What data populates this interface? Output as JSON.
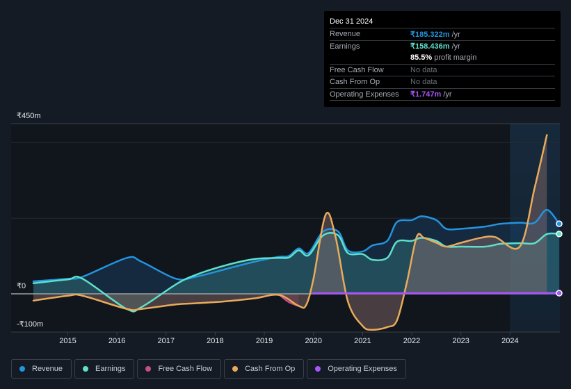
{
  "tooltip": {
    "date": "Dec 31 2024",
    "rows": [
      {
        "label": "Revenue",
        "value": "₹185.322m",
        "unit": " /yr",
        "color": "#2394df"
      },
      {
        "label": "Earnings",
        "value": "₹158.436m",
        "unit": " /yr",
        "color": "#5ee0cb"
      },
      {
        "label": "",
        "value": "85.5%",
        "unit": " profit margin",
        "color": "#ffffff"
      },
      {
        "label": "Free Cash Flow",
        "value": "No data",
        "unit": "",
        "color": "#6b7078"
      },
      {
        "label": "Cash From Op",
        "value": "No data",
        "unit": "",
        "color": "#6b7078"
      },
      {
        "label": "Operating Expenses",
        "value": "₹1.747m",
        "unit": " /yr",
        "color": "#a855f7"
      }
    ]
  },
  "legend": [
    {
      "label": "Revenue",
      "color": "#2394df"
    },
    {
      "label": "Earnings",
      "color": "#5ee0cb"
    },
    {
      "label": "Free Cash Flow",
      "color": "#c44e86"
    },
    {
      "label": "Cash From Op",
      "color": "#e9ab5b"
    },
    {
      "label": "Operating Expenses",
      "color": "#a855f7"
    }
  ],
  "chart_data": {
    "type": "area",
    "title": "",
    "xlabel": "",
    "ylabel": "",
    "y_tick_labels": [
      "₹450m",
      "₹0",
      "-₹100m"
    ],
    "x_tick_labels": [
      "2015",
      "2016",
      "2017",
      "2018",
      "2019",
      "2020",
      "2021",
      "2022",
      "2023",
      "2024"
    ],
    "ylim": [
      -100,
      450
    ],
    "xlim": [
      2014.3,
      2025.0
    ],
    "highlight_from": 2024.0,
    "series": [
      {
        "name": "Revenue",
        "color": "#2394df",
        "x": [
          2014.3,
          2015.0,
          2015.3,
          2016.2,
          2016.5,
          2017.2,
          2017.6,
          2018.2,
          2018.8,
          2019.3,
          2019.5,
          2019.7,
          2019.9,
          2020.2,
          2020.5,
          2020.7,
          2021.0,
          2021.2,
          2021.5,
          2021.7,
          2022.0,
          2022.2,
          2022.5,
          2022.7,
          2023.0,
          2023.5,
          2023.8,
          2024.2,
          2024.5,
          2024.75,
          2025.0
        ],
        "values": [
          33,
          40,
          45,
          95,
          85,
          40,
          45,
          65,
          85,
          98,
          100,
          120,
          108,
          165,
          165,
          115,
          112,
          128,
          140,
          190,
          195,
          205,
          195,
          172,
          172,
          178,
          185,
          188,
          188,
          222,
          185.3
        ]
      },
      {
        "name": "Earnings",
        "color": "#5ee0cb",
        "x": [
          2014.3,
          2015.0,
          2015.3,
          2016.2,
          2016.5,
          2017.2,
          2017.6,
          2018.2,
          2018.8,
          2019.3,
          2019.5,
          2019.7,
          2019.9,
          2020.2,
          2020.5,
          2020.7,
          2021.0,
          2021.2,
          2021.5,
          2021.7,
          2022.0,
          2022.2,
          2022.5,
          2022.7,
          2023.0,
          2023.5,
          2023.8,
          2024.2,
          2024.5,
          2024.75,
          2025.0
        ],
        "values": [
          28,
          38,
          40,
          -40,
          -35,
          25,
          50,
          75,
          92,
          95,
          96,
          115,
          102,
          155,
          155,
          108,
          105,
          90,
          95,
          138,
          140,
          148,
          140,
          125,
          125,
          125,
          132,
          134,
          134,
          158,
          158.4
        ]
      },
      {
        "name": "Free Cash Flow",
        "color": "#c44e86",
        "x": [
          2019.3,
          2019.5,
          2019.7
        ],
        "values": [
          -2,
          -22,
          -32
        ]
      },
      {
        "name": "Cash From Op",
        "color": "#e9ab5b",
        "x": [
          2014.3,
          2015.0,
          2015.3,
          2016.2,
          2016.5,
          2017.2,
          2017.6,
          2018.2,
          2018.8,
          2019.3,
          2019.7,
          2019.85,
          2020.0,
          2020.25,
          2020.45,
          2020.7,
          2021.0,
          2021.2,
          2021.5,
          2021.7,
          2021.9,
          2022.1,
          2022.25,
          2022.5,
          2022.7,
          2023.0,
          2023.4,
          2023.7,
          2024.2,
          2024.5,
          2024.75
        ],
        "values": [
          -18,
          -5,
          -5,
          -40,
          -40,
          -28,
          -25,
          -20,
          -12,
          -3,
          -32,
          -30,
          40,
          210,
          150,
          -20,
          -85,
          -95,
          -88,
          -70,
          30,
          150,
          148,
          135,
          125,
          135,
          148,
          150,
          125,
          280,
          420
        ]
      },
      {
        "name": "Operating Expenses",
        "color": "#a855f7",
        "x": [
          2020.0,
          2021.0,
          2022.0,
          2023.0,
          2024.0,
          2025.0
        ],
        "values": [
          1.2,
          1.3,
          1.4,
          1.5,
          1.6,
          1.747
        ]
      }
    ]
  }
}
